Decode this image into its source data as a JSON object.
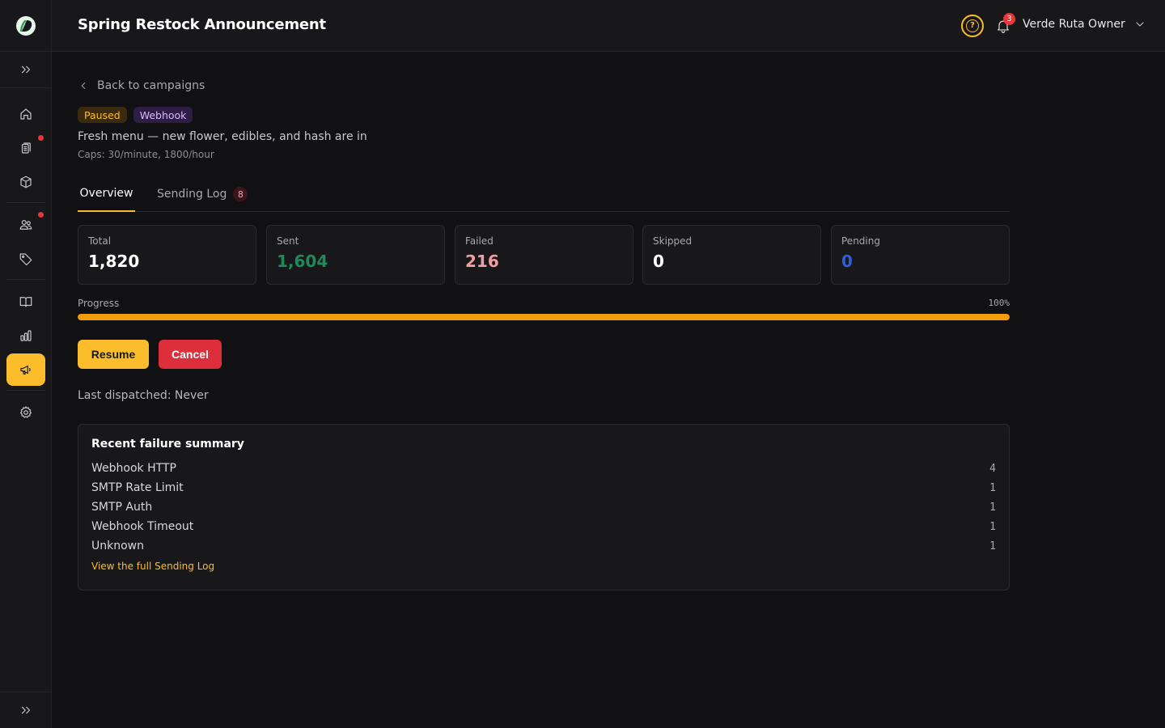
{
  "header": {
    "title": "Spring Restock Announcement",
    "help_label": "?",
    "notification_count": "3",
    "user_name": "Verde Ruta Owner"
  },
  "sidebar": {
    "items": [
      {
        "name": "home",
        "icon": "home-icon",
        "alert": false,
        "active": false
      },
      {
        "name": "orders",
        "icon": "clipboard-icon",
        "alert": true,
        "active": false
      },
      {
        "name": "products",
        "icon": "box-icon",
        "alert": false,
        "active": false
      },
      {
        "name": "customers",
        "icon": "users-icon",
        "alert": true,
        "active": false
      },
      {
        "name": "tags",
        "icon": "tag-icon",
        "alert": false,
        "active": false
      },
      {
        "name": "catalog",
        "icon": "book-icon",
        "alert": false,
        "active": false
      },
      {
        "name": "analytics",
        "icon": "bar-chart-icon",
        "alert": false,
        "active": false
      },
      {
        "name": "campaigns",
        "icon": "megaphone-icon",
        "alert": false,
        "active": true
      },
      {
        "name": "settings",
        "icon": "gear-icon",
        "alert": false,
        "active": false
      }
    ]
  },
  "back_link": "Back to campaigns",
  "badges": {
    "status": "Paused",
    "channel": "Webhook"
  },
  "campaign": {
    "subtitle": "Fresh menu — new flower, edibles, and hash are in",
    "caps": "Caps: 30/minute, 1800/hour"
  },
  "tabs": {
    "overview": "Overview",
    "sending_log": "Sending Log",
    "sending_log_count": "8"
  },
  "stats": {
    "total": {
      "label": "Total",
      "value": "1,820"
    },
    "sent": {
      "label": "Sent",
      "value": "1,604"
    },
    "failed": {
      "label": "Failed",
      "value": "216"
    },
    "skipped": {
      "label": "Skipped",
      "value": "0"
    },
    "pending": {
      "label": "Pending",
      "value": "0"
    }
  },
  "progress": {
    "label": "Progress",
    "percent_label": "100%",
    "fraction": 1.0
  },
  "actions": {
    "resume": "Resume",
    "cancel": "Cancel"
  },
  "last_dispatched": "Last dispatched: Never",
  "failure_summary": {
    "title": "Recent failure summary",
    "rows": [
      {
        "reason": "Webhook HTTP",
        "count": "4"
      },
      {
        "reason": "SMTP Rate Limit",
        "count": "1"
      },
      {
        "reason": "SMTP Auth",
        "count": "1"
      },
      {
        "reason": "Webhook Timeout",
        "count": "1"
      },
      {
        "reason": "Unknown",
        "count": "1"
      }
    ],
    "link": "View the full Sending Log"
  },
  "colors": {
    "accent": "#fbbd2c",
    "danger": "#dc2f3b",
    "sent": "#1d8a5a",
    "failed": "#f19da1",
    "pending": "#2f5fd6",
    "progress": "#f59e0b"
  }
}
